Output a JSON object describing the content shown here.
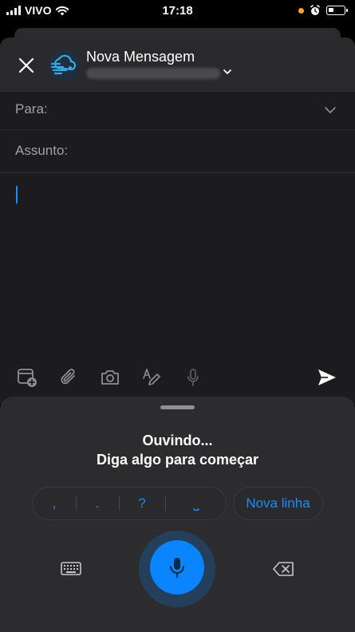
{
  "status_bar": {
    "carrier": "VIVO",
    "time": "17:18",
    "icons": [
      "signal-bars-icon",
      "wifi-icon",
      "orange-dot-icon",
      "alarm-icon",
      "battery-icon"
    ]
  },
  "compose": {
    "title": "Nova Mensagem",
    "sender_account": "",
    "to_label": "Para:",
    "subject_label": "Assunto:",
    "body": ""
  },
  "toolbar": {
    "icons": [
      "calendar-add-icon",
      "paperclip-icon",
      "camera-icon",
      "text-format-icon",
      "microphone-icon",
      "send-icon"
    ]
  },
  "dictation": {
    "status_line1": "Ouvindo...",
    "status_line2": "Diga algo para começar",
    "punctuation": [
      ",",
      ".",
      "?",
      "⎵"
    ],
    "new_line_label": "Nova linha"
  },
  "colors": {
    "accent": "#0a84ff",
    "sheet_background": "#1c1c1e",
    "panel_background": "#2c2c2e",
    "label_gray": "#a0a0a5"
  }
}
